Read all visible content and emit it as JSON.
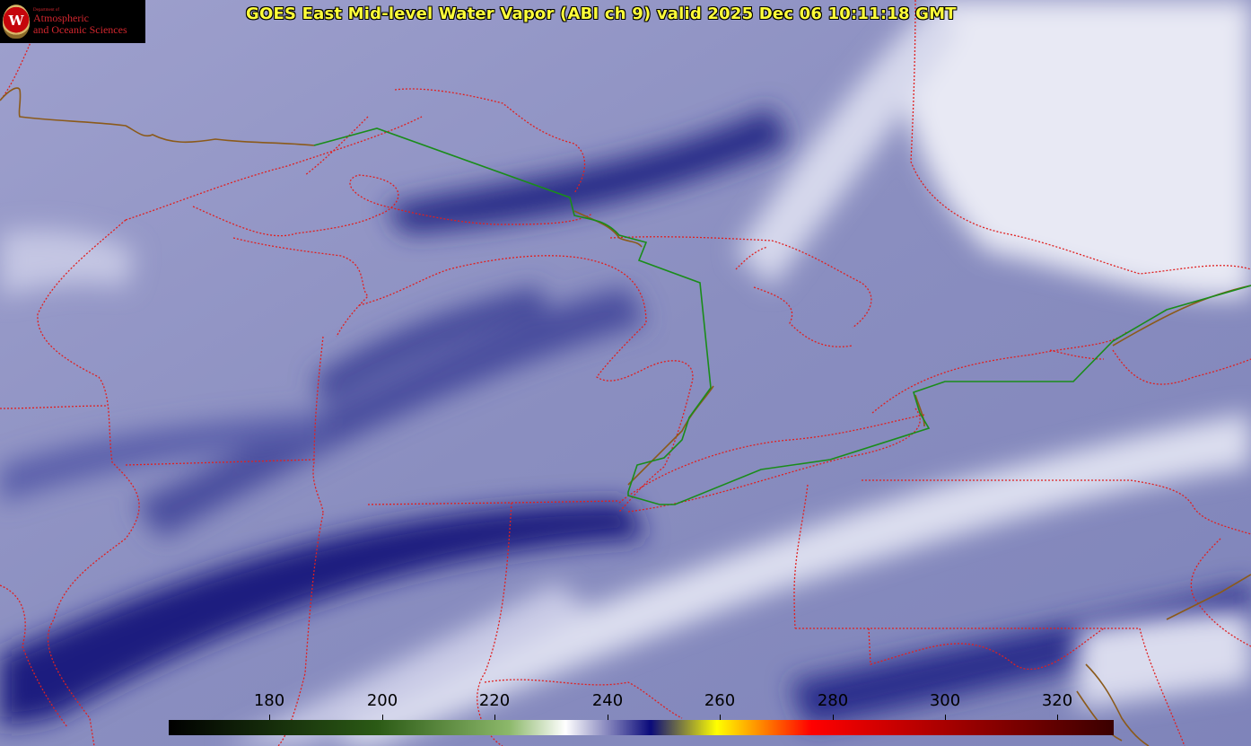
{
  "header": {
    "title": "GOES East Mid-level Water Vapor (ABI ch 9)  valid 2025 Dec 06 10:11:18 GMT"
  },
  "logo": {
    "seal_letter": "W",
    "department": "Department of",
    "line1": "Atmospheric",
    "line2": "and Oceanic Sciences"
  },
  "colorbar": {
    "ticks": [
      "180",
      "200",
      "220",
      "240",
      "260",
      "280",
      "300",
      "320"
    ],
    "colors": [
      "#000000",
      "#2b5a15",
      "#8cb86a",
      "#ffffff",
      "#0a0a7a",
      "#ffff00",
      "#ff0000",
      "#3a0000"
    ]
  },
  "map_colors": {
    "state_borders": "#e02020",
    "international_border": "#1a8c1a",
    "coastline": "#8b5a1a"
  }
}
